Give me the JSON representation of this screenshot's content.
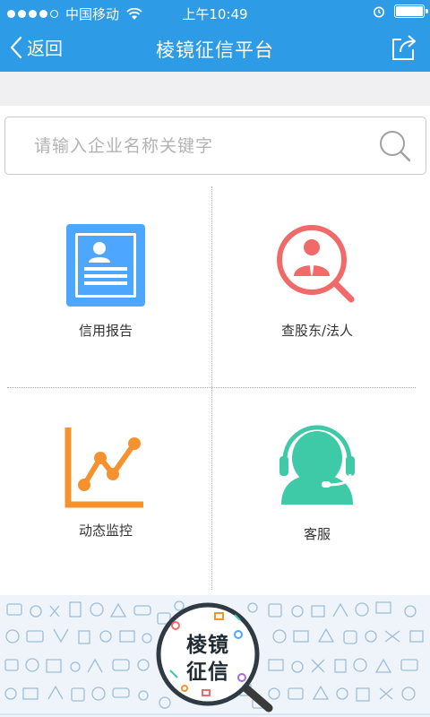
{
  "status_bar": {
    "carrier": "中国移动",
    "time": "上午10:49"
  },
  "nav": {
    "back_label": "返回",
    "title": "棱镜征信平台"
  },
  "search": {
    "placeholder": "请输入企业名称关键字",
    "value": ""
  },
  "grid": {
    "items": [
      {
        "label": "信用报告",
        "icon": "credit-report-icon",
        "color": "#4da6ff"
      },
      {
        "label": "查股东/法人",
        "icon": "shareholder-search-icon",
        "color": "#f06a6a"
      },
      {
        "label": "动态监控",
        "icon": "dynamic-monitor-icon",
        "color": "#f5922f"
      },
      {
        "label": "客服",
        "icon": "customer-service-icon",
        "color": "#3ec9a7"
      }
    ]
  },
  "footer": {
    "logo_line1": "棱镜",
    "logo_line2": "征信"
  },
  "colors": {
    "primary": "#2e9be6",
    "background": "#f0f0f2",
    "pattern": "#8fb4d4"
  }
}
